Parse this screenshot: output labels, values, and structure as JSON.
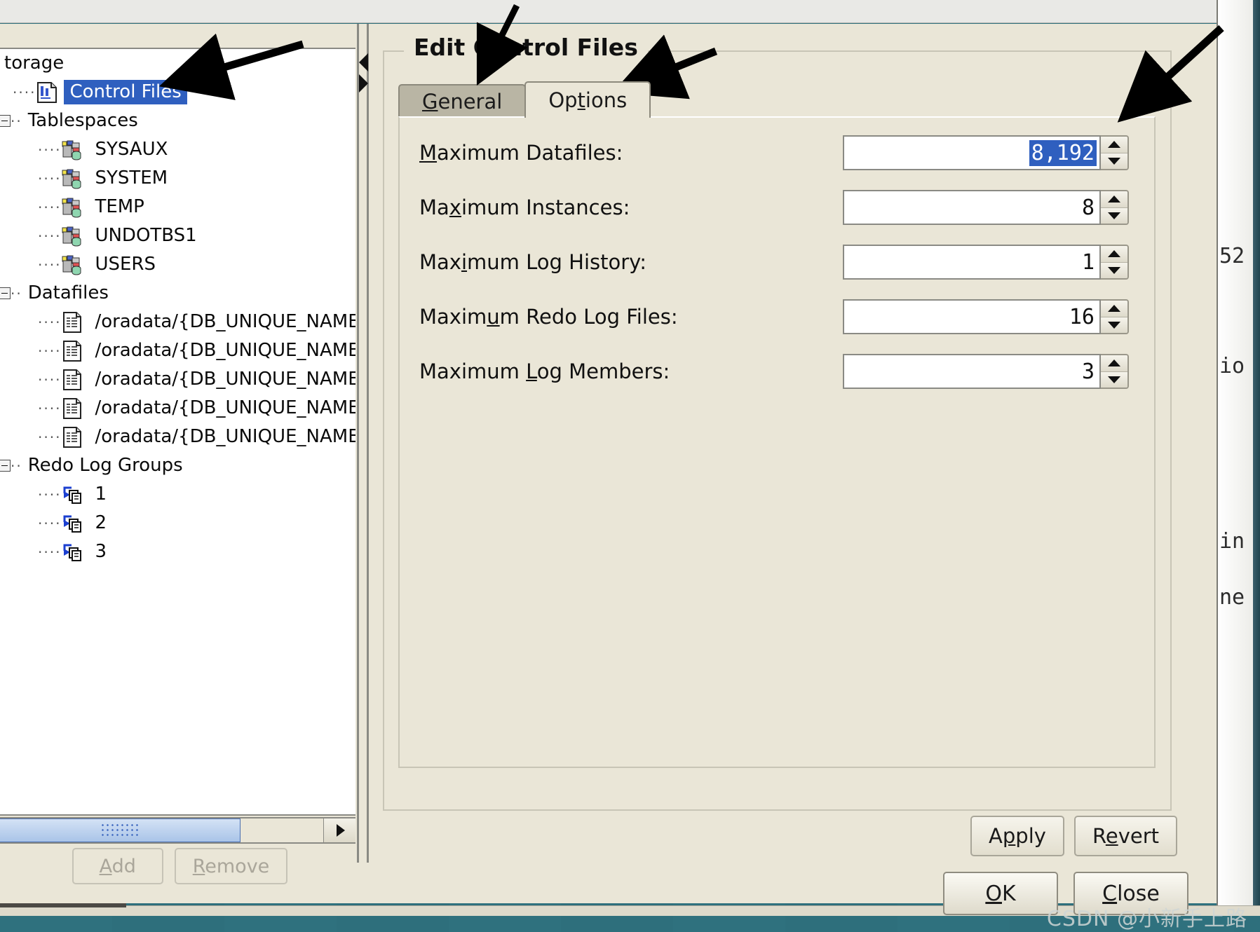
{
  "dialog": {
    "group_title": "Edit Control Files",
    "tabs": [
      {
        "label": "General",
        "mnemonic": "G",
        "active": false
      },
      {
        "label": "Options",
        "mnemonic": "t",
        "active": true
      }
    ],
    "fields": [
      {
        "label_pre": "M",
        "label_post": "aximum Datafiles:",
        "label_full": "Maximum Datafiles:",
        "value": "8,192",
        "selected": true
      },
      {
        "label_pre": "Ma",
        "label_mn": "x",
        "label_post": "imum Instances:",
        "label_full": "Maximum Instances:",
        "value": "8",
        "selected": false
      },
      {
        "label_pre": "Max",
        "label_mn": "i",
        "label_post": "mum Log History:",
        "label_full": "Maximum Log History:",
        "value": "1",
        "selected": false
      },
      {
        "label_pre": "Maxim",
        "label_mn": "u",
        "label_post": "m Redo Log Files:",
        "label_full": "Maximum Redo Log Files:",
        "value": "16",
        "selected": false
      },
      {
        "label_pre": "Maximum ",
        "label_mn": "L",
        "label_post": "og Members:",
        "label_full": "Maximum Log Members:",
        "value": "3",
        "selected": false
      }
    ],
    "apply_label": "Apply",
    "revert_label": "Revert",
    "ok_label": "OK",
    "close_label": "Close"
  },
  "tree": {
    "nodes": [
      {
        "label": "torage",
        "indent": 0,
        "icon": "none",
        "expander": false,
        "selected": false
      },
      {
        "label": "Control Files",
        "indent": 1,
        "icon": "control-file",
        "expander": false,
        "selected": true
      },
      {
        "label": "Tablespaces",
        "indent": 0,
        "icon": "none",
        "expander": true,
        "selected": false
      },
      {
        "label": "SYSAUX",
        "indent": 2,
        "icon": "tablespace",
        "expander": false,
        "selected": false
      },
      {
        "label": "SYSTEM",
        "indent": 2,
        "icon": "tablespace",
        "expander": false,
        "selected": false
      },
      {
        "label": "TEMP",
        "indent": 2,
        "icon": "tablespace",
        "expander": false,
        "selected": false
      },
      {
        "label": "UNDOTBS1",
        "indent": 2,
        "icon": "tablespace",
        "expander": false,
        "selected": false
      },
      {
        "label": "USERS",
        "indent": 2,
        "icon": "tablespace",
        "expander": false,
        "selected": false
      },
      {
        "label": "Datafiles",
        "indent": 0,
        "icon": "none",
        "expander": true,
        "selected": false
      },
      {
        "label": "/oradata/{DB_UNIQUE_NAME}/s",
        "indent": 2,
        "icon": "datafile",
        "expander": false,
        "selected": false
      },
      {
        "label": "/oradata/{DB_UNIQUE_NAME}/u",
        "indent": 2,
        "icon": "datafile",
        "expander": false,
        "selected": false
      },
      {
        "label": "/oradata/{DB_UNIQUE_NAME}/s",
        "indent": 2,
        "icon": "datafile",
        "expander": false,
        "selected": false
      },
      {
        "label": "/oradata/{DB_UNIQUE_NAME}/t",
        "indent": 2,
        "icon": "datafile",
        "expander": false,
        "selected": false
      },
      {
        "label": "/oradata/{DB_UNIQUE_NAME}/u",
        "indent": 2,
        "icon": "datafile",
        "expander": false,
        "selected": false
      },
      {
        "label": "Redo Log Groups",
        "indent": 0,
        "icon": "none",
        "expander": true,
        "selected": false
      },
      {
        "label": "1",
        "indent": 2,
        "icon": "redolog",
        "expander": false,
        "selected": false
      },
      {
        "label": "2",
        "indent": 2,
        "icon": "redolog",
        "expander": false,
        "selected": false
      },
      {
        "label": "3",
        "indent": 2,
        "icon": "redolog",
        "expander": false,
        "selected": false
      }
    ],
    "add_label": "Add",
    "remove_label": "Remove"
  },
  "background_window": {
    "fragments": [
      "52",
      "io",
      "in",
      "ne"
    ]
  },
  "watermark": "CSDN @小新手上路",
  "colors": {
    "dialog_bg": "#eae6d7",
    "selection_blue": "#2f5fbf",
    "tab_inactive": "#b9b5a4",
    "desktop_teal": "#2f717e",
    "border_gray": "#8a8a84"
  }
}
